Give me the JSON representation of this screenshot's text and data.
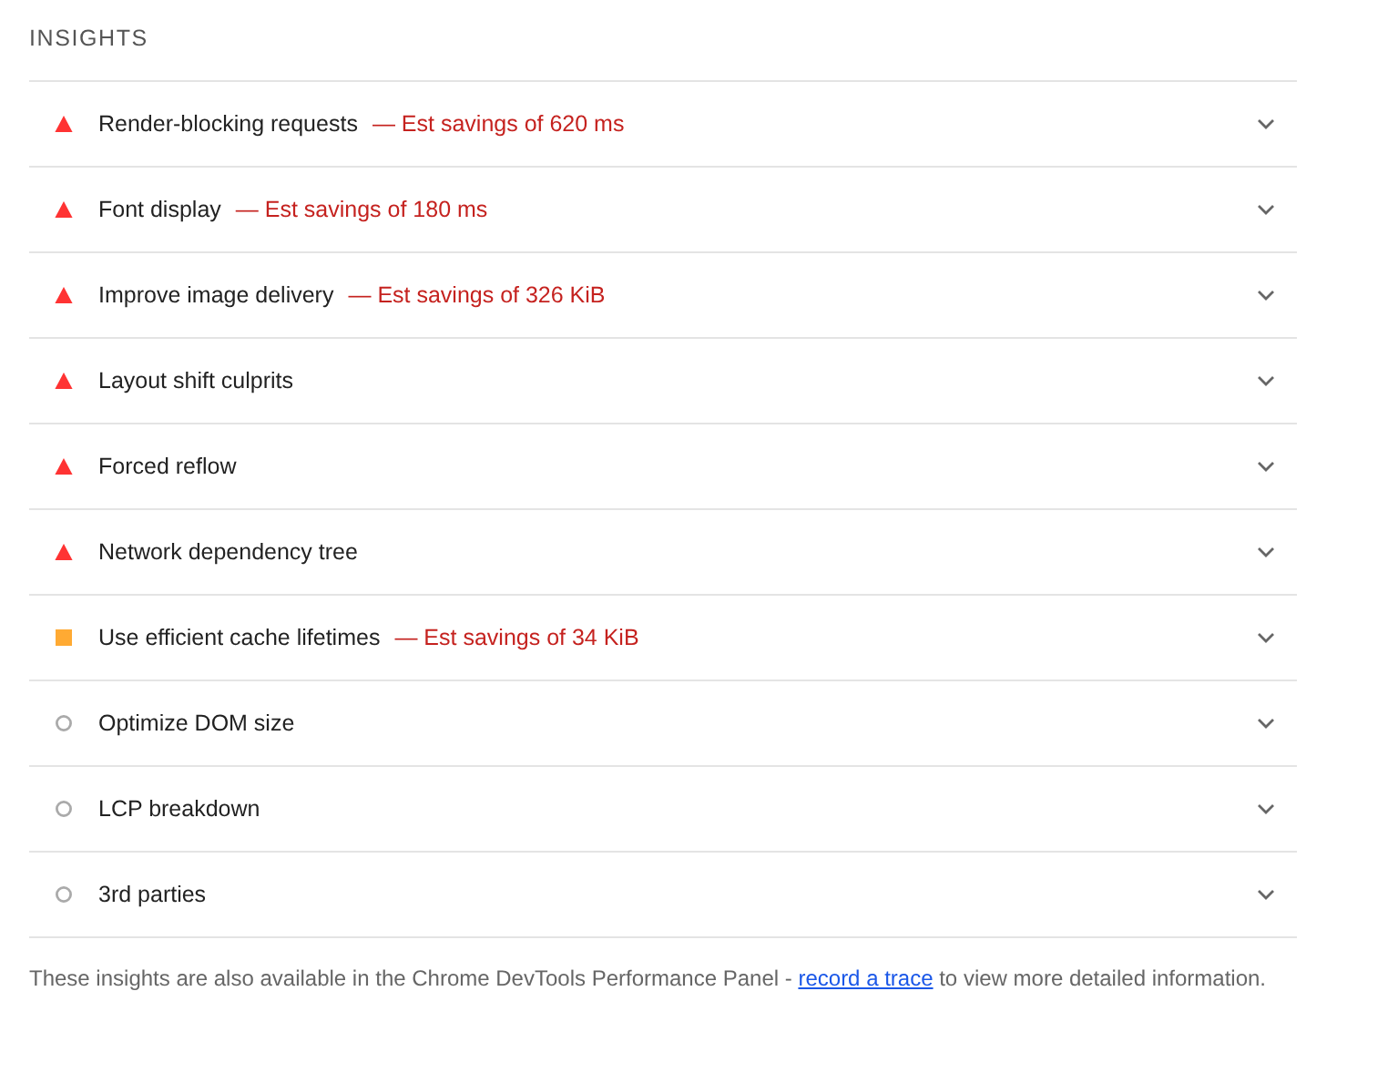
{
  "heading": "INSIGHTS",
  "insights": [
    {
      "kind": "fail",
      "title": "Render-blocking requests",
      "savings": "— Est savings of 620 ms",
      "expanded": false
    },
    {
      "kind": "fail",
      "title": "Font display",
      "savings": "— Est savings of 180 ms",
      "expanded": false
    },
    {
      "kind": "fail",
      "title": "Improve image delivery",
      "savings": "— Est savings of 326 KiB",
      "expanded": false
    },
    {
      "kind": "fail",
      "title": "Layout shift culprits",
      "expanded": false
    },
    {
      "kind": "fail",
      "title": "Forced reflow",
      "expanded": false
    },
    {
      "kind": "fail",
      "title": "Network dependency tree",
      "expanded": false
    },
    {
      "kind": "average",
      "title": "Use efficient cache lifetimes",
      "savings": "— Est savings of 34 KiB",
      "expanded": false
    },
    {
      "kind": "info",
      "title": "Optimize DOM size",
      "expanded": false
    },
    {
      "kind": "info",
      "title": "LCP breakdown",
      "expanded": false
    },
    {
      "kind": "info",
      "title": "3rd parties",
      "expanded": false
    }
  ],
  "footer": {
    "before": "These insights are also available in the Chrome DevTools Performance Panel - ",
    "link": "record a trace",
    "after": " to view more detailed information."
  }
}
